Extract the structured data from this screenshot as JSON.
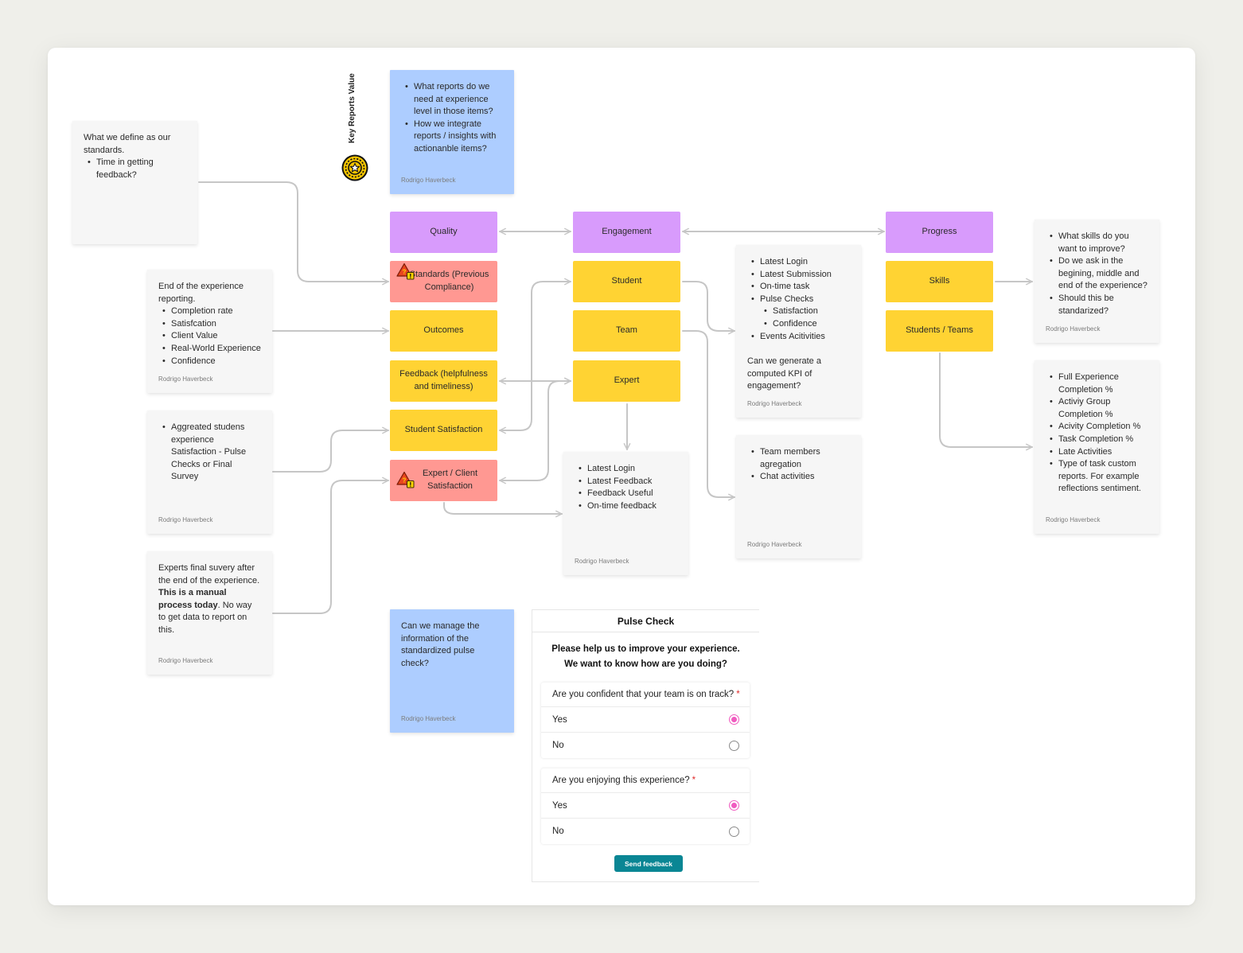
{
  "title_label": "Key Reports Value",
  "badge_icon": "star-coin-icon",
  "colors": {
    "category": "#d89bfc",
    "metric": "#ffd333",
    "warning": "#ff9892",
    "question_note": "#adcdff",
    "note": "#f6f6f6",
    "connector": "#c6c6c6",
    "radio_selected": "#f05cc0",
    "button": "#0a8694"
  },
  "notes": {
    "standards_def": {
      "intro": "What we define as our standards.",
      "items": [
        "Time in getting feedback?"
      ]
    },
    "key_reports": {
      "items": [
        "What reports do we need at experience level in those items?",
        "How we integrate reports / insights with actionanble items?"
      ],
      "author": "Rodrigo Haverbeck"
    },
    "end_reporting": {
      "intro": "End of the experience reporting.",
      "items": [
        "Completion rate",
        "Satisfcation",
        "Client Value",
        "Real-World Experience",
        "Confidence"
      ],
      "author": "Rodrigo Haverbeck"
    },
    "aggregated": {
      "items": [
        "Aggreated studens experience Satisfaction - Pulse Checks or Final Survey"
      ],
      "author": "Rodrigo Haverbeck"
    },
    "experts_survey": {
      "text_1": "Experts final suvery after the end of the experience. ",
      "bold": "This is a manual process today",
      "text_2": ". No way to get data to report on this.",
      "author": "Rodrigo Haverbeck"
    },
    "student_metrics": {
      "items": [
        "Latest Login",
        "Latest Submission",
        "On-time task",
        "Pulse Checks"
      ],
      "sub_items": [
        "Satisfaction",
        "Confidence"
      ],
      "items_after": [
        "Events Acitivities"
      ],
      "question": "Can we generate a computed KPI of engagement?",
      "author": "Rodrigo Haverbeck"
    },
    "expert_metrics": {
      "items": [
        "Latest Login",
        "Latest Feedback",
        "Feedback Useful",
        "On-time feedback"
      ],
      "author": "Rodrigo Haverbeck"
    },
    "team_metrics": {
      "items": [
        "Team members agregation",
        "Chat activities"
      ],
      "author": "Rodrigo Haverbeck"
    },
    "skills_questions": {
      "items": [
        "What skills do you want to improve?",
        "Do we ask in the begining, middle and end of the experience?",
        "Should this be standarized?"
      ],
      "author": "Rodrigo Haverbeck"
    },
    "completion_metrics": {
      "items": [
        "Full Experience Completion %",
        "Activiy Group Completion %",
        "Acivity Completion %",
        "Task Completion %",
        "Late Activities",
        "Type of task custom reports. For example reflections sentiment."
      ],
      "author": "Rodrigo Haverbeck"
    },
    "pulse_question": {
      "text": "Can we manage the information of the standardized pulse check?",
      "author": "Rodrigo Haverbeck"
    }
  },
  "boxes": {
    "quality": "Quality",
    "engagement": "Engagement",
    "progress": "Progress",
    "standards": "Standards (Previous Compliance)",
    "outcomes": "Outcomes",
    "feedback": "Feedback (helpfulness and timeliness)",
    "student_satisfaction": "Student Satisfaction",
    "expert_client_satisfaction": "Expert / Client Satisfaction",
    "student": "Student",
    "team": "Team",
    "expert": "Expert",
    "skills": "Skills",
    "students_teams": "Students / Teams"
  },
  "pulse_form": {
    "title": "Pulse Check",
    "intro_line1": "Please help us to improve your experience.",
    "intro_line2": "We want to know how are you doing?",
    "questions": [
      {
        "label": "Are you confident that your team is on track?",
        "required_mark": "*",
        "options": [
          "Yes",
          "No"
        ],
        "selected": "Yes"
      },
      {
        "label": "Are you enjoying this experience?",
        "required_mark": "*",
        "options": [
          "Yes",
          "No"
        ],
        "selected": "Yes"
      }
    ],
    "submit_label": "Send feedback"
  }
}
